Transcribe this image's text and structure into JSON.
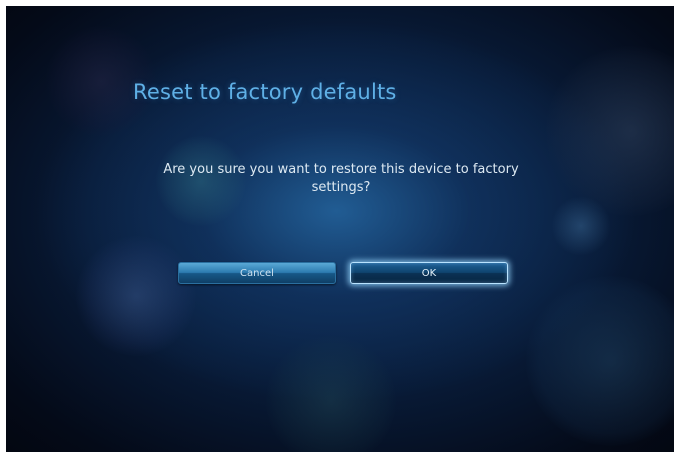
{
  "dialog": {
    "title": "Reset to factory defaults",
    "message": "Are you sure you want to restore this device to factory settings?",
    "buttons": {
      "cancel_label": "Cancel",
      "ok_label": "OK"
    },
    "focused_button": "OK"
  },
  "colors": {
    "title": "#5fb0e6",
    "background": "#081a36",
    "focus_glow": "#b9e3ff"
  }
}
